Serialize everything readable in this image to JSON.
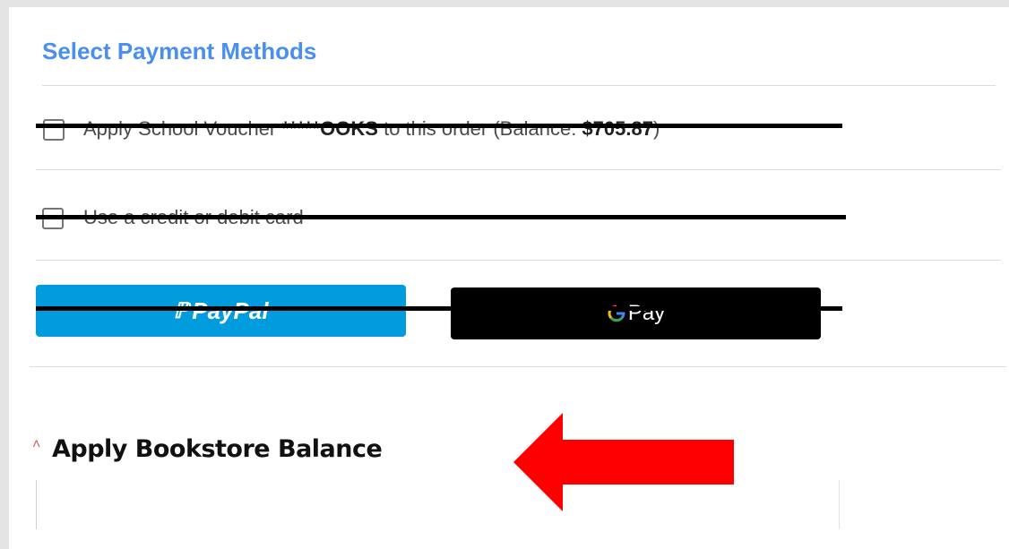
{
  "section": {
    "title": "Select Payment Methods"
  },
  "options": {
    "voucher": {
      "prefix": "Apply School Voucher ",
      "masked_code": "*****OOKS",
      "middle": " to this order (Balance: ",
      "balance": "$705.87",
      "suffix": ")",
      "checked": false
    },
    "card": {
      "label": "Use a credit or debit card",
      "checked": false
    }
  },
  "buttons": {
    "paypal_label": "PayPal",
    "gpay_label": "Pay",
    "paypal_color": "#009cde",
    "gpay_color": "#000000"
  },
  "bookstore": {
    "title": "Apply Bookstore Balance"
  },
  "colors": {
    "title_blue": "#4a8ef0",
    "arrow_red": "#ff0000",
    "strike_black": "#000000"
  }
}
